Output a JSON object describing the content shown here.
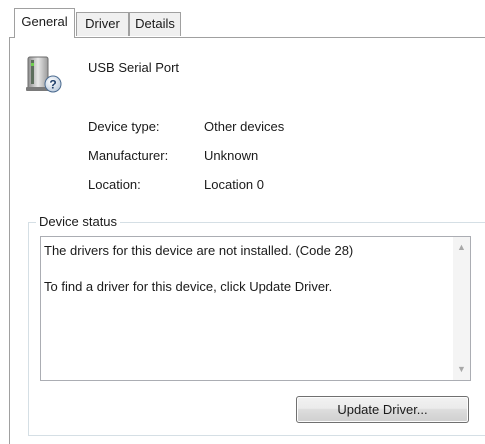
{
  "tabs": [
    {
      "label": "General",
      "active": true
    },
    {
      "label": "Driver",
      "active": false
    },
    {
      "label": "Details",
      "active": false
    }
  ],
  "device": {
    "icon": "unknown-device-icon",
    "name": "USB Serial Port"
  },
  "properties": [
    {
      "label": "Device type:",
      "value": "Other devices"
    },
    {
      "label": "Manufacturer:",
      "value": "Unknown"
    },
    {
      "label": "Location:",
      "value": "Location 0"
    }
  ],
  "device_status": {
    "title": "Device status",
    "text": "The drivers for this device are not installed. (Code 28)\n\nTo find a driver for this device, click Update Driver."
  },
  "buttons": {
    "update_driver": "Update Driver..."
  }
}
